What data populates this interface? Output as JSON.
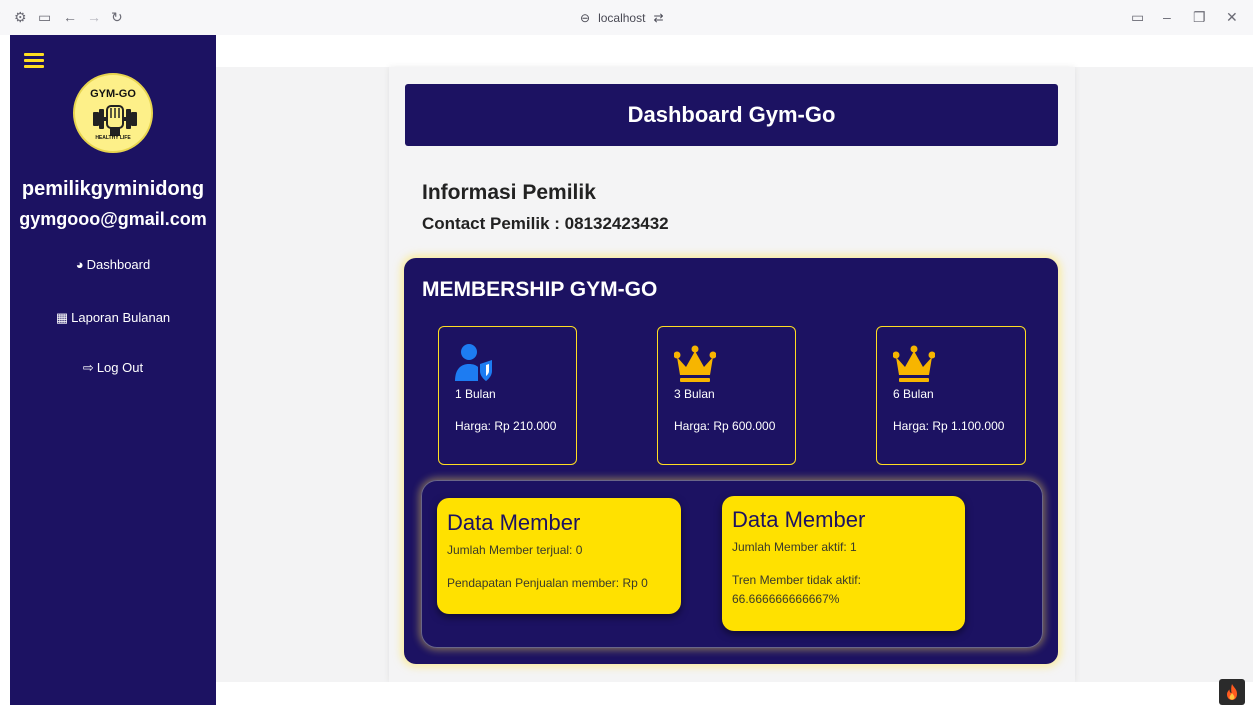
{
  "browser": {
    "url": "localhost"
  },
  "sidebar": {
    "owner_name": "pemilikgyminidong",
    "owner_email": "gymgooo@gmail.com",
    "logo": {
      "top_text": "GYM-GO",
      "bottom_text": "HEALTHY LIFE"
    },
    "nav": [
      {
        "label": "Dashboard",
        "icon": "tachometer-icon"
      },
      {
        "label": "Laporan Bulanan",
        "icon": "calendar-icon"
      },
      {
        "label": "Log Out",
        "icon": "sign-out-icon"
      }
    ]
  },
  "header": {
    "title": "Dashboard Gym-Go"
  },
  "info": {
    "title": "Informasi Pemilik",
    "contact": "Contact Pemilik : 08132423432"
  },
  "membership": {
    "title": "MEMBERSHIP GYM-GO",
    "plans": [
      {
        "name": "1 Bulan",
        "price": "Harga: Rp 210.000",
        "icon": "user-shield-icon"
      },
      {
        "name": "3 Bulan",
        "price": "Harga: Rp 600.000",
        "icon": "crown-icon"
      },
      {
        "name": "6 Bulan",
        "price": "Harga: Rp 1.100.000",
        "icon": "crown-icon"
      }
    ]
  },
  "data_cards": [
    {
      "title": "Data Member",
      "line1": "Jumlah Member terjual: 0",
      "line2": "Pendapatan Penjualan member: Rp 0"
    },
    {
      "title": "Data Member",
      "line1": "Jumlah Member aktif: 1",
      "line2": "Tren Member tidak aktif:",
      "line3": "66.666666666667%"
    }
  ],
  "colors": {
    "navy": "#1c1262",
    "yellow": "#ffe100",
    "accent_blue": "#1d7cf2",
    "crown": "#f7b500"
  }
}
